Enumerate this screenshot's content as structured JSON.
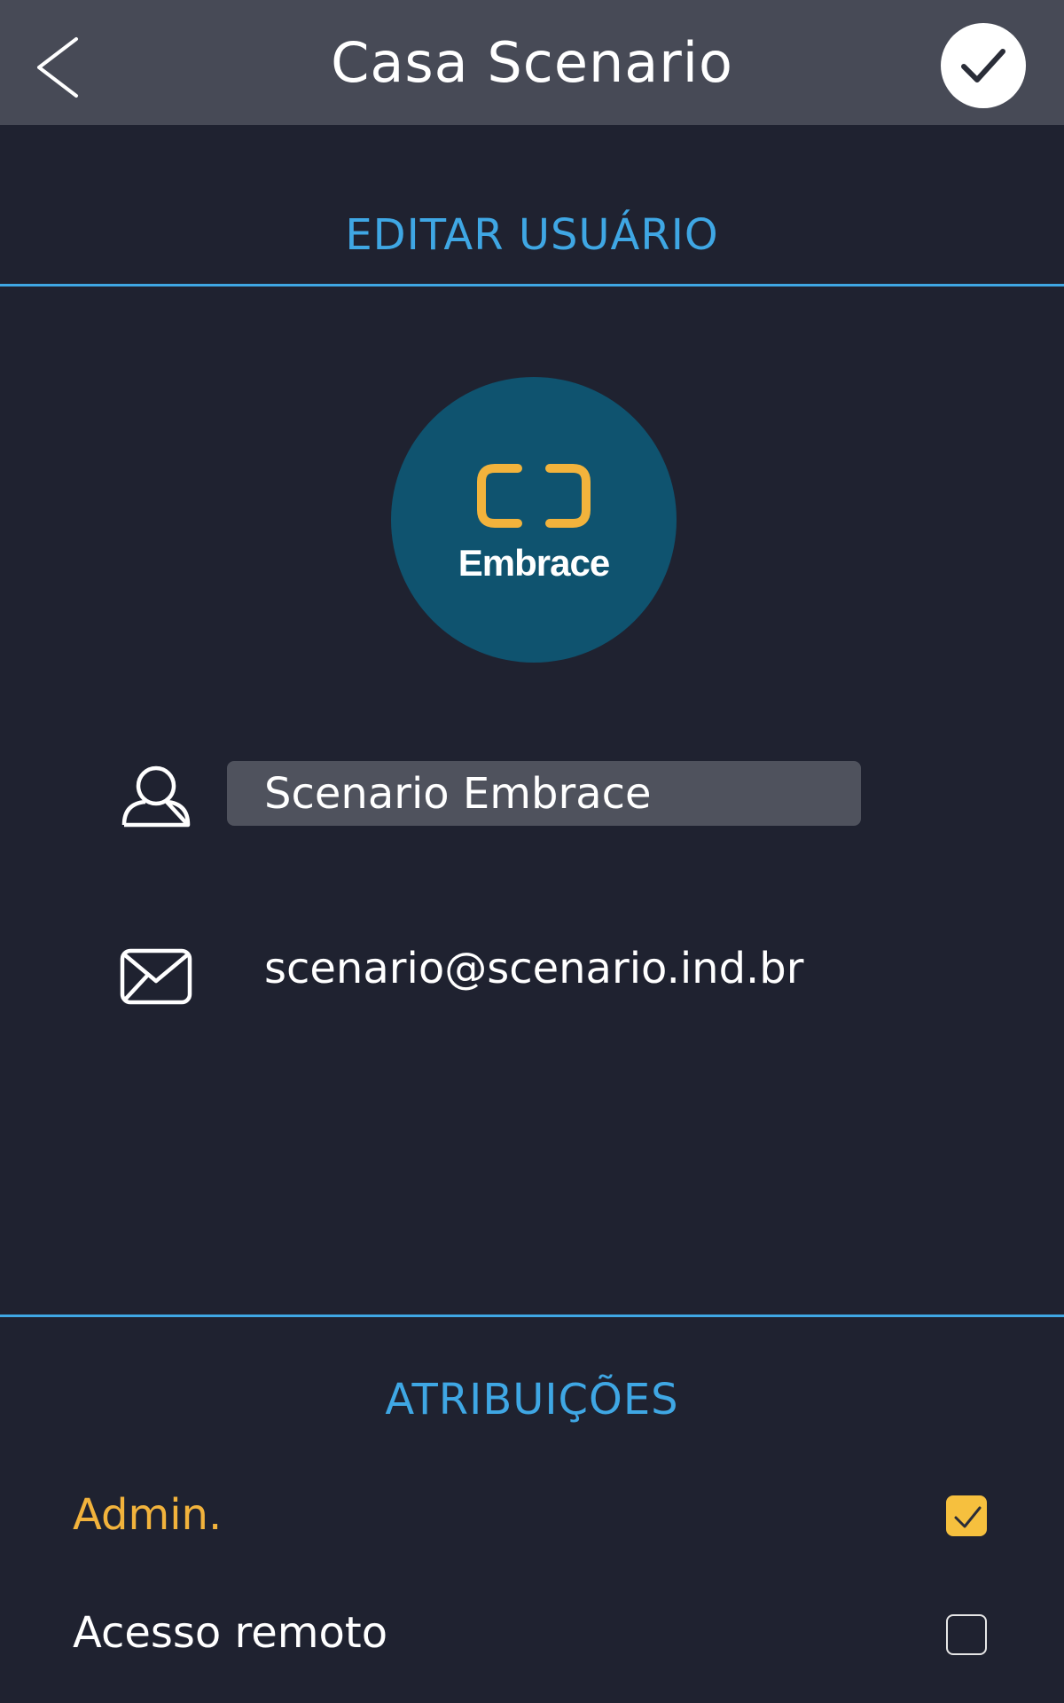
{
  "header": {
    "title": "Casa Scenario",
    "back_icon": "chevron-left-icon",
    "confirm_icon": "checkmark-icon"
  },
  "edit_section": {
    "title": "EDITAR USUÁRIO"
  },
  "avatar": {
    "label": "Embrace",
    "background_color": "#0f536f",
    "mark_color": "#f2b33c"
  },
  "user": {
    "name": "Scenario Embrace",
    "email": "scenario@scenario.ind.br",
    "name_icon": "user-icon",
    "email_icon": "envelope-icon"
  },
  "roles_section": {
    "title": "ATRIBUIÇÕES",
    "items": [
      {
        "label": "Admin.",
        "checked": true
      },
      {
        "label": "Acesso remoto",
        "checked": false
      }
    ]
  },
  "colors": {
    "accent_blue": "#3fa7e4",
    "accent_yellow": "#f2b33c",
    "background": "#1f2230",
    "header": "#474a56"
  }
}
